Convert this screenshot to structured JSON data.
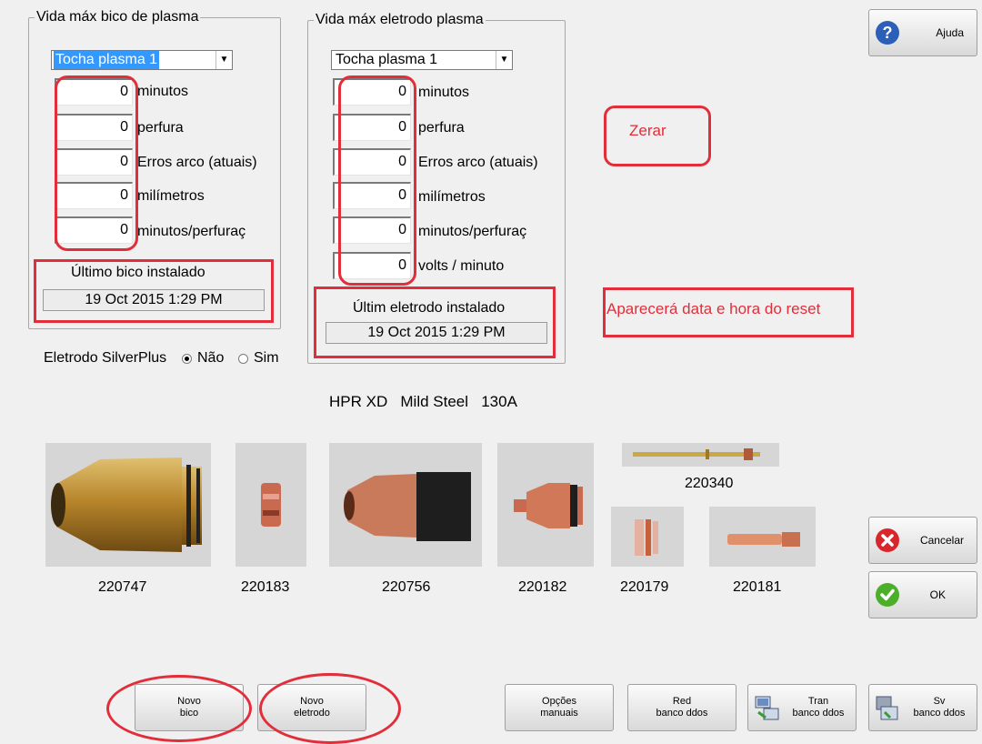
{
  "nozzle_group": {
    "title": "Vida máx bico de plasma",
    "torch_select": "Tocha plasma 1",
    "fields": [
      {
        "value": "0",
        "label": "minutos"
      },
      {
        "value": "0",
        "label": "perfura"
      },
      {
        "value": "0",
        "label": "Erros arco (atuais)"
      },
      {
        "value": "0",
        "label": "milímetros"
      },
      {
        "value": "0",
        "label": "minutos/perfuraç"
      }
    ],
    "last_installed_label": "Último bico instalado",
    "last_installed_date": "19 Oct 2015  1:29 PM"
  },
  "electrode_group": {
    "title": "Vida máx eletrodo plasma",
    "torch_select": "Tocha plasma 1",
    "fields": [
      {
        "value": "0",
        "label": "minutos"
      },
      {
        "value": "0",
        "label": "perfura"
      },
      {
        "value": "0",
        "label": "Erros arco (atuais)"
      },
      {
        "value": "0",
        "label": "milímetros"
      },
      {
        "value": "0",
        "label": "minutos/perfuraç"
      },
      {
        "value": "0",
        "label": "volts / minuto"
      }
    ],
    "last_installed_label": "Últim eletrodo instalado",
    "last_installed_date": "19 Oct 2015  1:29 PM"
  },
  "silverplus": {
    "label": "Eletrodo SilverPlus",
    "option_no": "Não",
    "option_yes": "Sim",
    "selected": "Não"
  },
  "annotations": {
    "zerar": "Zerar",
    "reset_note": "Aparecerá data e hora do reset"
  },
  "process_title": "HPR XD   Mild Steel   130A",
  "parts": [
    {
      "number": "220747"
    },
    {
      "number": "220183"
    },
    {
      "number": "220756"
    },
    {
      "number": "220182"
    },
    {
      "number": "220340"
    },
    {
      "number": "220179"
    },
    {
      "number": "220181"
    }
  ],
  "side_buttons": {
    "help": "Ajuda",
    "cancel": "Cancelar",
    "ok": "OK"
  },
  "bottom_buttons": [
    {
      "line1": "Novo",
      "line2": "bico"
    },
    {
      "line1": "Novo",
      "line2": "eletrodo"
    },
    {
      "line1": "Opções",
      "line2": "manuais"
    },
    {
      "line1": "Red",
      "line2": "banco ddos"
    },
    {
      "line1": "Tran",
      "line2": "banco ddos"
    },
    {
      "line1": "Sv",
      "line2": "banco ddos"
    }
  ],
  "colors": {
    "annotation_red": "#e22d3a",
    "selection_blue": "#3399ff",
    "cancel_red": "#d9262c",
    "ok_green": "#4caf2a",
    "help_blue": "#2b5fb8"
  }
}
